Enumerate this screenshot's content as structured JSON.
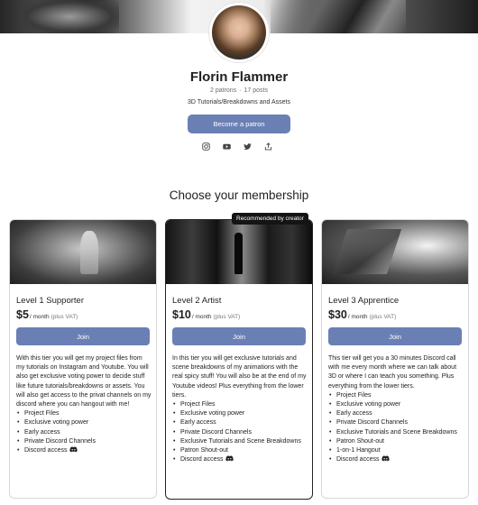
{
  "creator": {
    "name": "Florin Flammer",
    "patrons": "2 patrons",
    "posts": "17 posts",
    "tagline": "3D Tutorials/Breakdowns and Assets",
    "become_button": "Become a patron",
    "socials": [
      "instagram-icon",
      "youtube-icon",
      "twitter-icon",
      "share-icon"
    ]
  },
  "membership": {
    "heading": "Choose your membership",
    "recommended_badge": "Recommended by creator",
    "tiers": [
      {
        "title": "Level 1 Supporter",
        "price": "$5",
        "per": "/ month",
        "vat": "(plus VAT)",
        "join": "Join",
        "description": "With this tier you will get my project files from my tutorials on Instagram and Youtube. You will also get exclusive voting power to decide stuff like future tutorials/breakdowns or assets. You will also get access to the privat channels on my discord where you can hangout with me!",
        "benefits": [
          "Project Files",
          "Exclusive voting power",
          "Early access",
          "Private Discord Channels",
          "Discord access"
        ]
      },
      {
        "title": "Level 2 Artist",
        "price": "$10",
        "per": "/ month",
        "vat": "(plus VAT)",
        "join": "Join",
        "description": "In this tier you will get exclusive tutorials and scene breakdowns of my animations with the real spicy stuff! You will also be at the end of my Youtube videos! Plus everything from the lower tiers.",
        "benefits": [
          "Project Files",
          "Exclusive voting power",
          "Early access",
          "Private Discord Channels",
          "Exclusive Tutorials and Scene Breakdowns",
          "Patron Shout-out",
          "Discord access"
        ]
      },
      {
        "title": "Level 3 Apprentice",
        "price": "$30",
        "per": "/ month",
        "vat": "(plus VAT)",
        "join": "Join",
        "description": "This tier will get you a 30 minutes Discord call with me every month where we can talk about 3D or where I can teach you something. Plus everything from the lower tiers.",
        "benefits": [
          "Project Files",
          "Exclusive voting power",
          "Early access",
          "Private Discord Channels",
          "Exclusive Tutorials and Scene Breakdowns",
          "Patron Shout-out",
          "1-on-1 Hangout",
          "Discord access"
        ]
      }
    ]
  },
  "colors": {
    "accent": "#6a80b5",
    "badge": "#141414"
  }
}
